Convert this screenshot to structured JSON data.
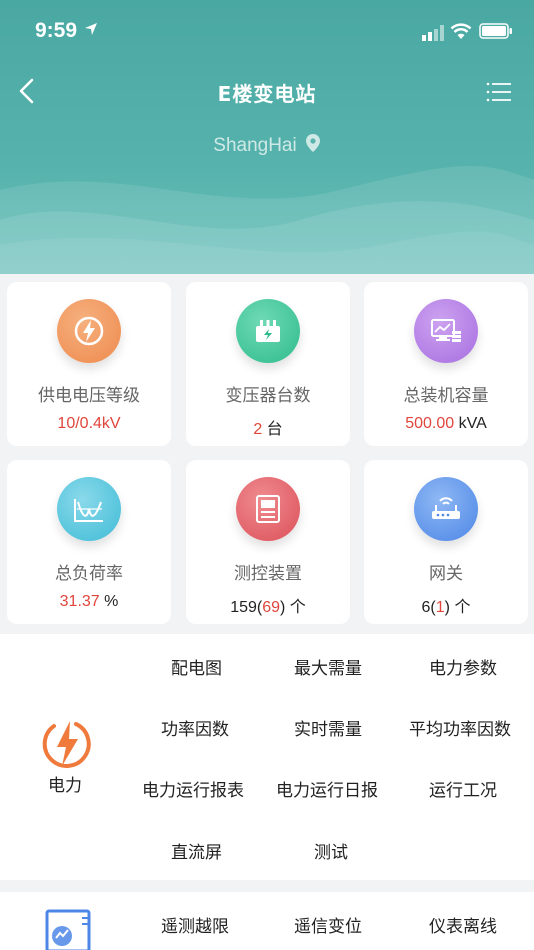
{
  "status": {
    "time": "9:59"
  },
  "nav": {
    "title": "E楼变电站",
    "location": "ShangHai"
  },
  "cards": [
    {
      "label": "供电电压等级",
      "value_red": "10/0.4kV",
      "value_suffix": "",
      "icon": "lightning-icon",
      "color": "#f0955a"
    },
    {
      "label": "变压器台数",
      "value_red": "2",
      "value_suffix": " 台",
      "icon": "transformer-icon",
      "color": "#3fc79c"
    },
    {
      "label": "总装机容量",
      "value_red": "500.00",
      "value_suffix": " kVA",
      "icon": "monitor-icon",
      "color": "#b27de5"
    },
    {
      "label": "总负荷率",
      "value_red": "31.37",
      "value_suffix": " %",
      "icon": "load-curve-icon",
      "color": "#4fc4dd"
    },
    {
      "label": "测控装置",
      "value_prefix": "159(",
      "value_red": "69",
      "value_suffix": ") 个",
      "icon": "device-icon",
      "color": "#e2646b"
    },
    {
      "label": "网关",
      "value_prefix": "6(",
      "value_red": "1",
      "value_suffix": ") 个",
      "icon": "gateway-icon",
      "color": "#5f97ea"
    }
  ],
  "power": {
    "label": "电力",
    "items": [
      "配电图",
      "最大需量",
      "电力参数",
      "功率因数",
      "实时需量",
      "平均功率因数",
      "电力运行报表",
      "电力运行日报",
      "运行工况",
      "直流屏",
      "测试"
    ]
  },
  "alarm": {
    "items": [
      "遥测越限",
      "遥信变位",
      "仪表离线"
    ]
  },
  "colors": {
    "header": "#4aa8a2",
    "accent_red": "#e0463c",
    "power_orange": "#f07a3c"
  }
}
